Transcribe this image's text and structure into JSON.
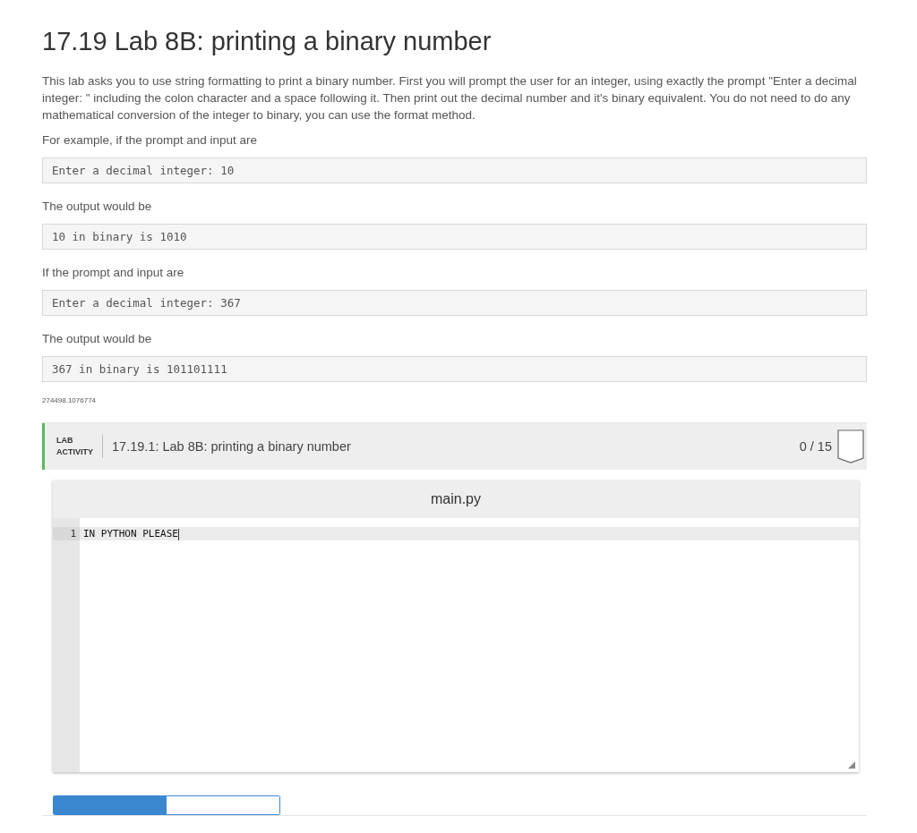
{
  "title": "17.19 Lab 8B: printing a binary number",
  "content": [
    {
      "kind": "text",
      "text": "This lab asks you to use string formatting to print a binary number. First you will prompt the user for an integer, using exactly the prompt \"Enter a decimal integer: \" including the colon character and a space following it. Then print out the decimal number and it's binary equivalent. You do not need to do any mathematical conversion of the integer to binary, you can use the format method."
    },
    {
      "kind": "text",
      "text": "For example, if the prompt and input are"
    },
    {
      "kind": "code",
      "text": "Enter a decimal integer: 10"
    },
    {
      "kind": "text",
      "text": "The output would be"
    },
    {
      "kind": "code",
      "text": "10 in binary is 1010"
    },
    {
      "kind": "text",
      "text": "If the prompt and input are"
    },
    {
      "kind": "code",
      "text": "Enter a decimal integer: 367"
    },
    {
      "kind": "text",
      "text": "The output would be"
    },
    {
      "kind": "code",
      "text": "367 in binary is 101101111"
    }
  ],
  "content_id": "274498.1076774",
  "lab": {
    "badge_line_1": "LAB",
    "badge_line_2": "ACTIVITY",
    "title": "17.19.1: Lab 8B: printing a binary number",
    "score": "0 / 15",
    "editor": {
      "filename": "main.py",
      "lines": [
        {
          "number": "1",
          "code": "IN PYTHON PLEASE",
          "selected": true
        }
      ]
    },
    "mode_toggle": [
      {
        "selected": true
      },
      {
        "selected": false
      }
    ]
  }
}
